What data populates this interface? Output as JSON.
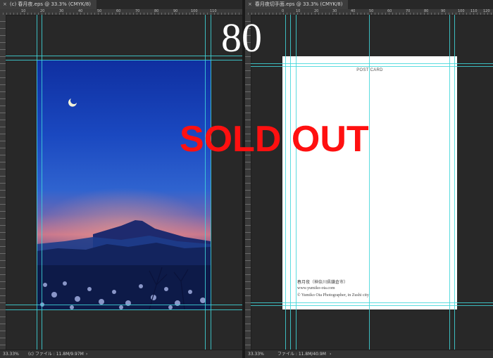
{
  "left_window": {
    "tab_title": "(c) 春月夜.eps @ 33.3% (CMYK/8)",
    "ruler_labels": [
      "10",
      "20",
      "30",
      "40",
      "50",
      "60",
      "70",
      "80",
      "90",
      "100",
      "110"
    ],
    "zoom": "33.33%",
    "file_info": "(c) ファイル : 11.8M/9.97M"
  },
  "right_window": {
    "tab_title": "春月夜切手面.eps @ 33.3% (CMYK/8)",
    "ruler_labels": [
      "0",
      "10",
      "20",
      "30",
      "40",
      "50",
      "60",
      "70",
      "80",
      "90",
      "100",
      "110",
      "120"
    ],
    "zoom": "33.33%",
    "file_info": "ファイル : 11.8M/40.9M"
  },
  "postcard": {
    "header": "POST CARD",
    "caption_title": "春月夜（神奈川県鎌倉市）",
    "website": "www.yumiko-ota.com",
    "copyright": "© Yumiko Ota Photographer, in Zushi city"
  },
  "overlay": {
    "price": "80",
    "sold_out": "SOLD OUT"
  },
  "colors": {
    "guide": "#3fd6d9",
    "sold_out": "#ff1010",
    "workspace": "#282828"
  }
}
